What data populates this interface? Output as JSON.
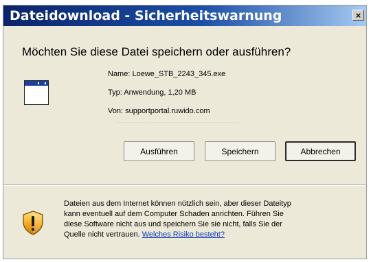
{
  "window": {
    "title": "Dateidownload - Sicherheitswarnung",
    "close_label": "×"
  },
  "dialog": {
    "question": "Möchten Sie diese Datei speichern oder ausführen?",
    "file_icon": "application-window-icon",
    "name_label": "Name:",
    "name_value": "Loewe_STB_2243_345.exe",
    "type_label": "Typ:",
    "type_value": "Anwendung, 1,20 MB",
    "from_label": "Von:",
    "from_value": "supportportal.ruwido.com"
  },
  "buttons": {
    "run": "Ausführen",
    "save": "Speichern",
    "cancel": "Abbrechen"
  },
  "warning": {
    "icon": "security-shield-warning-icon",
    "text_line1": "Dateien aus dem Internet können nützlich sein, aber dieser Dateityp",
    "text_line2": "kann eventuell auf dem Computer Schaden anrichten. Führen Sie",
    "text_line3": "diese Software nicht aus und speichern Sie sie nicht, falls Sie der",
    "text_line4": "Quelle nicht vertrauen.",
    "link": "Welches Risiko besteht?"
  },
  "colors": {
    "title_gradient_start": "#0a246a",
    "title_gradient_end": "#a6caf0",
    "dialog_background": "#ece9d8",
    "link": "#0a3bbd"
  }
}
